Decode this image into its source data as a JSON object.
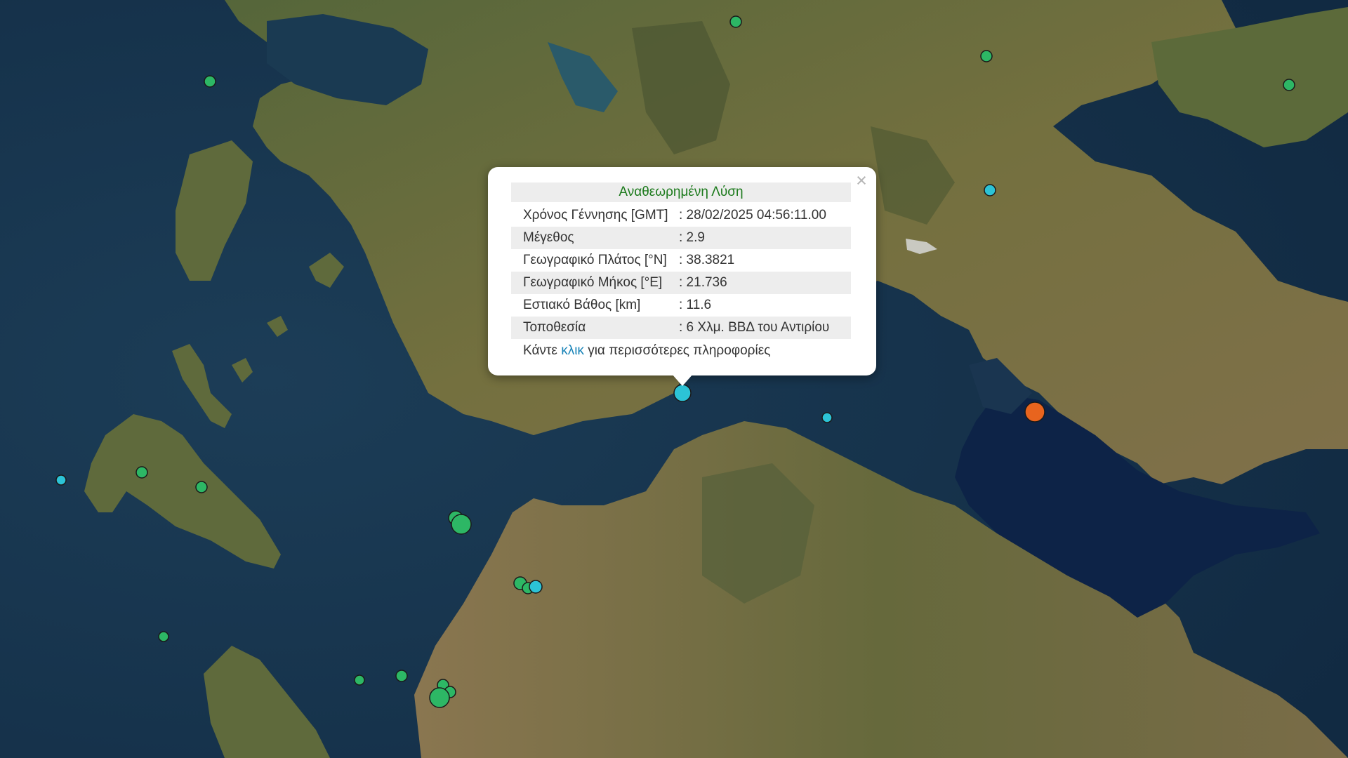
{
  "popup": {
    "title": "Αναθεωρημένη Λύση",
    "close_symbol": "×",
    "rows": [
      {
        "label": "Χρόνος Γέννησης [GMT]",
        "value": ": 28/02/2025 04:56:11.00"
      },
      {
        "label": "Μέγεθος",
        "value": ": 2.9"
      },
      {
        "label": "Γεωγραφικό Πλάτος [°N]",
        "value": ": 38.3821"
      },
      {
        "label": "Γεωγραφικό Μήκος [°E]",
        "value": ": 21.736"
      },
      {
        "label": "Εστιακό Βάθος [km]",
        "value": ": 11.6"
      },
      {
        "label": "Τοποθεσία",
        "value": ": 6 Χλμ. ΒΒΔ του Αντιρίου"
      }
    ],
    "more": {
      "prefix": "Κάντε",
      "link": "κλικ",
      "suffix": "για περισσότερες πληροφορίες"
    }
  },
  "colors": {
    "sea": "#14304a",
    "deep_sea": "#0d2347",
    "land": "#6a6a3a",
    "marker_green": "#2db765",
    "marker_cyan": "#2cc3d6",
    "marker_orange": "#e8641e",
    "popup_title": "#1c7a1c",
    "link": "#1a84b8"
  }
}
